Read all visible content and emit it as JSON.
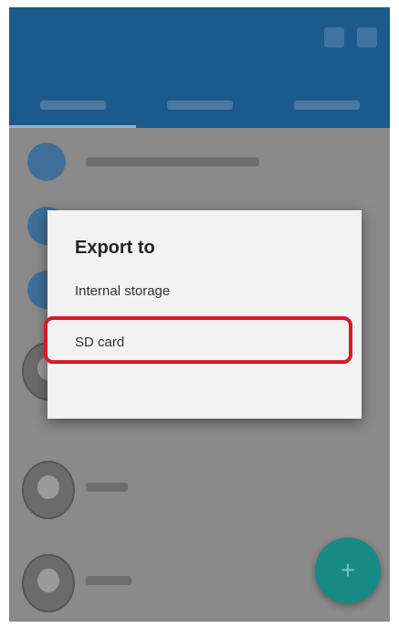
{
  "appbar": {
    "title": ""
  },
  "tabs": [
    {
      "label": ""
    },
    {
      "label": ""
    },
    {
      "label": ""
    }
  ],
  "dialog": {
    "title": "Export to",
    "options": [
      {
        "label": "Internal storage",
        "state": "normal"
      },
      {
        "label": "SD card",
        "state": "highlighted"
      },
      {
        "label": "",
        "state": "disabled"
      }
    ]
  },
  "fab": {
    "icon": "plus-icon"
  },
  "colors": {
    "appbar": "#1d5a8c",
    "highlight": "#d61a2a",
    "fab": "#178a86"
  }
}
